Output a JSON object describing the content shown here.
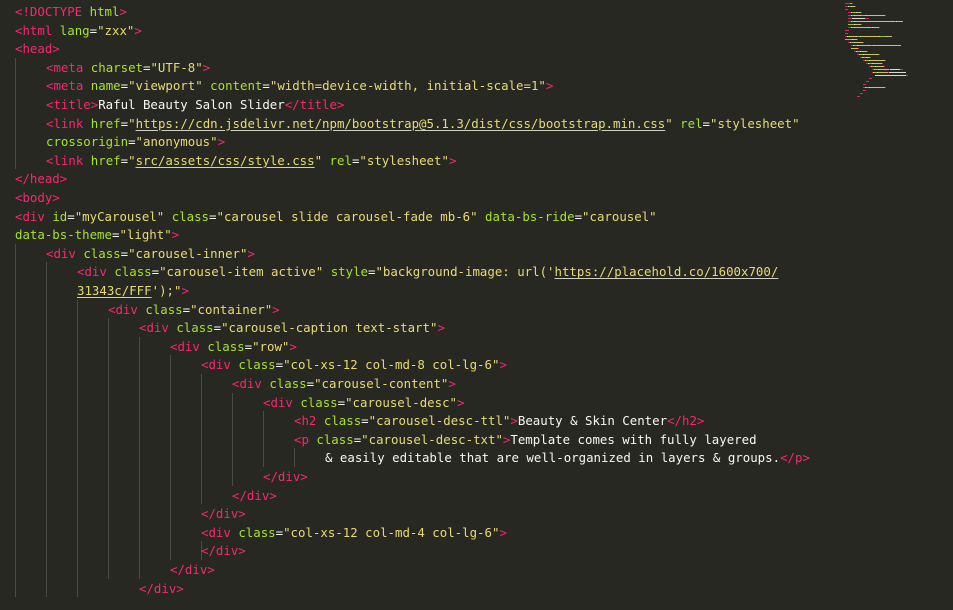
{
  "editor": {
    "theme": {
      "background": "#272822",
      "tag": "#f92672",
      "attribute": "#a6e22e",
      "string": "#e6db74",
      "text": "#f8f8f2",
      "guide": "#4a4b44"
    },
    "lines": [
      {
        "indent": 0,
        "segments": [
          [
            "tg",
            "<!DOCTYPE "
          ],
          [
            "at",
            "html"
          ],
          [
            "tg",
            ">"
          ]
        ]
      },
      {
        "indent": 0,
        "segments": [
          [
            "tg",
            "<html"
          ],
          [
            "pl",
            " "
          ],
          [
            "at",
            "lang"
          ],
          [
            "pl",
            "="
          ],
          [
            "st",
            "\"zxx\""
          ],
          [
            "tg",
            ">"
          ]
        ]
      },
      {
        "indent": 0,
        "segments": [
          [
            "tg",
            "<head>"
          ]
        ]
      },
      {
        "indent": 1,
        "segments": [
          [
            "tg",
            "<meta"
          ],
          [
            "pl",
            " "
          ],
          [
            "at",
            "charset"
          ],
          [
            "pl",
            "="
          ],
          [
            "st",
            "\"UTF-8\""
          ],
          [
            "tg",
            ">"
          ]
        ]
      },
      {
        "indent": 1,
        "segments": [
          [
            "tg",
            "<meta"
          ],
          [
            "pl",
            " "
          ],
          [
            "at",
            "name"
          ],
          [
            "pl",
            "="
          ],
          [
            "st",
            "\"viewport\""
          ],
          [
            "pl",
            " "
          ],
          [
            "at",
            "content"
          ],
          [
            "pl",
            "="
          ],
          [
            "st",
            "\"width=device-width, initial-scale=1\""
          ],
          [
            "tg",
            ">"
          ]
        ]
      },
      {
        "indent": 1,
        "segments": [
          [
            "tg",
            "<title>"
          ],
          [
            "pl",
            "Raful Beauty Salon Slider"
          ],
          [
            "tg",
            "</title>"
          ]
        ]
      },
      {
        "indent": 1,
        "segments": [
          [
            "tg",
            "<link"
          ],
          [
            "pl",
            " "
          ],
          [
            "at",
            "href"
          ],
          [
            "pl",
            "="
          ],
          [
            "st",
            "\""
          ],
          [
            "st ul",
            "https://cdn.jsdelivr.net/npm/bootstrap@5.1.3/dist/css/bootstrap.min.css"
          ],
          [
            "st",
            "\""
          ],
          [
            "pl",
            " "
          ],
          [
            "at",
            "rel"
          ],
          [
            "pl",
            "="
          ],
          [
            "st",
            "\"stylesheet\""
          ]
        ]
      },
      {
        "indent": 1,
        "segments": [
          [
            "at",
            "crossorigin"
          ],
          [
            "pl",
            "="
          ],
          [
            "st",
            "\"anonymous\""
          ],
          [
            "tg",
            ">"
          ]
        ]
      },
      {
        "indent": 1,
        "segments": [
          [
            "tg",
            "<link"
          ],
          [
            "pl",
            " "
          ],
          [
            "at",
            "href"
          ],
          [
            "pl",
            "="
          ],
          [
            "st",
            "\""
          ],
          [
            "st ul",
            "src/assets/css/style.css"
          ],
          [
            "st",
            "\""
          ],
          [
            "pl",
            " "
          ],
          [
            "at",
            "rel"
          ],
          [
            "pl",
            "="
          ],
          [
            "st",
            "\"stylesheet\""
          ],
          [
            "tg",
            ">"
          ]
        ]
      },
      {
        "indent": 0,
        "segments": [
          [
            "tg",
            "</head>"
          ]
        ]
      },
      {
        "indent": 0,
        "segments": [
          [
            "tg",
            "<body>"
          ]
        ]
      },
      {
        "indent": 0,
        "segments": [
          [
            "tg",
            "<div"
          ],
          [
            "pl",
            " "
          ],
          [
            "at",
            "id"
          ],
          [
            "pl",
            "="
          ],
          [
            "st",
            "\"myCarousel\""
          ],
          [
            "pl",
            " "
          ],
          [
            "at",
            "class"
          ],
          [
            "pl",
            "="
          ],
          [
            "st",
            "\"carousel slide carousel-fade mb-6\""
          ],
          [
            "pl",
            " "
          ],
          [
            "at",
            "data-bs-ride"
          ],
          [
            "pl",
            "="
          ],
          [
            "st",
            "\"carousel\""
          ]
        ]
      },
      {
        "indent": 0,
        "segments": [
          [
            "at",
            "data-bs-theme"
          ],
          [
            "pl",
            "="
          ],
          [
            "st",
            "\"light\""
          ],
          [
            "tg",
            ">"
          ]
        ]
      },
      {
        "indent": 1,
        "segments": [
          [
            "tg",
            "<div"
          ],
          [
            "pl",
            " "
          ],
          [
            "at",
            "class"
          ],
          [
            "pl",
            "="
          ],
          [
            "st",
            "\"carousel-inner\""
          ],
          [
            "tg",
            ">"
          ]
        ]
      },
      {
        "indent": 2,
        "segments": [
          [
            "tg",
            "<div"
          ],
          [
            "pl",
            " "
          ],
          [
            "at",
            "class"
          ],
          [
            "pl",
            "="
          ],
          [
            "st",
            "\"carousel-item active\""
          ],
          [
            "pl",
            " "
          ],
          [
            "at",
            "style"
          ],
          [
            "pl",
            "="
          ],
          [
            "st",
            "\"background-image: url('"
          ],
          [
            "st ul",
            "https://placehold.co/1600x700/"
          ]
        ]
      },
      {
        "indent": 2,
        "segments": [
          [
            "st ul",
            "31343c/FFF"
          ],
          [
            "st",
            "');\""
          ],
          [
            "tg",
            ">"
          ]
        ]
      },
      {
        "indent": 3,
        "segments": [
          [
            "tg",
            "<div"
          ],
          [
            "pl",
            " "
          ],
          [
            "at",
            "class"
          ],
          [
            "pl",
            "="
          ],
          [
            "st",
            "\"container\""
          ],
          [
            "tg",
            ">"
          ]
        ]
      },
      {
        "indent": 4,
        "segments": [
          [
            "tg",
            "<div"
          ],
          [
            "pl",
            " "
          ],
          [
            "at",
            "class"
          ],
          [
            "pl",
            "="
          ],
          [
            "st",
            "\"carousel-caption text-start\""
          ],
          [
            "tg",
            ">"
          ]
        ]
      },
      {
        "indent": 5,
        "segments": [
          [
            "tg",
            "<div"
          ],
          [
            "pl",
            " "
          ],
          [
            "at",
            "class"
          ],
          [
            "pl",
            "="
          ],
          [
            "st",
            "\"row\""
          ],
          [
            "tg",
            ">"
          ]
        ]
      },
      {
        "indent": 6,
        "segments": [
          [
            "tg",
            "<div"
          ],
          [
            "pl",
            " "
          ],
          [
            "at",
            "class"
          ],
          [
            "pl",
            "="
          ],
          [
            "st",
            "\"col-xs-12 col-md-8 col-lg-6\""
          ],
          [
            "tg",
            ">"
          ]
        ]
      },
      {
        "indent": 7,
        "segments": [
          [
            "tg",
            "<div"
          ],
          [
            "pl",
            " "
          ],
          [
            "at",
            "class"
          ],
          [
            "pl",
            "="
          ],
          [
            "st",
            "\"carousel-content\""
          ],
          [
            "tg",
            ">"
          ]
        ]
      },
      {
        "indent": 8,
        "segments": [
          [
            "tg",
            "<div"
          ],
          [
            "pl",
            " "
          ],
          [
            "at",
            "class"
          ],
          [
            "pl",
            "="
          ],
          [
            "st",
            "\"carousel-desc\""
          ],
          [
            "tg",
            ">"
          ]
        ]
      },
      {
        "indent": 9,
        "segments": [
          [
            "tg",
            "<h2"
          ],
          [
            "pl",
            " "
          ],
          [
            "at",
            "class"
          ],
          [
            "pl",
            "="
          ],
          [
            "st",
            "\"carousel-desc-ttl\""
          ],
          [
            "tg",
            ">"
          ],
          [
            "pl",
            "Beauty & Skin Center"
          ],
          [
            "tg",
            "</h2>"
          ]
        ]
      },
      {
        "indent": 9,
        "segments": [
          [
            "tg",
            "<p"
          ],
          [
            "pl",
            " "
          ],
          [
            "at",
            "class"
          ],
          [
            "pl",
            "="
          ],
          [
            "st",
            "\"carousel-desc-txt\""
          ],
          [
            "tg",
            ">"
          ],
          [
            "pl",
            "Template comes with fully layered"
          ]
        ]
      },
      {
        "indent": 10,
        "segments": [
          [
            "pl",
            "& easily editable that are well-organized in layers & groups."
          ],
          [
            "tg",
            "</p>"
          ]
        ]
      },
      {
        "indent": 8,
        "segments": [
          [
            "tg",
            "</div>"
          ]
        ]
      },
      {
        "indent": 7,
        "segments": [
          [
            "tg",
            "</div>"
          ]
        ]
      },
      {
        "indent": 6,
        "segments": [
          [
            "tg",
            "</div>"
          ]
        ]
      },
      {
        "indent": 6,
        "segments": [
          [
            "tg",
            "<div"
          ],
          [
            "pl",
            " "
          ],
          [
            "at",
            "class"
          ],
          [
            "pl",
            "="
          ],
          [
            "st",
            "\"col-xs-12 col-md-4 col-lg-6\""
          ],
          [
            "tg",
            ">"
          ]
        ]
      },
      {
        "indent": 6,
        "segments": [
          [
            "tg",
            "</div>"
          ]
        ]
      },
      {
        "indent": 5,
        "segments": [
          [
            "tg",
            "</div>"
          ]
        ]
      },
      {
        "indent": 4,
        "segments": [
          [
            "tg",
            "</div>"
          ]
        ]
      }
    ]
  }
}
